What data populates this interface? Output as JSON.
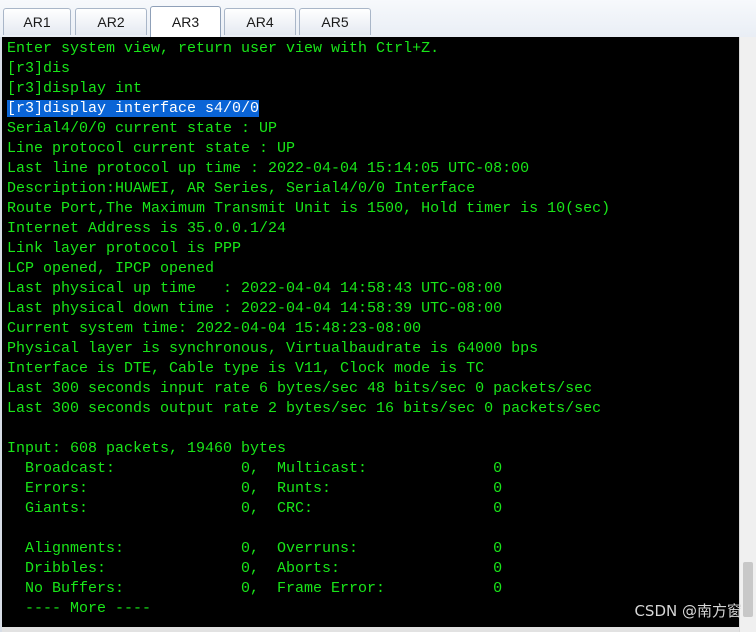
{
  "tabs": [
    {
      "label": "AR1",
      "active": false
    },
    {
      "label": "AR2",
      "active": false
    },
    {
      "label": "AR3",
      "active": true
    },
    {
      "label": "AR4",
      "active": false
    },
    {
      "label": "AR5",
      "active": false
    }
  ],
  "terminal": {
    "text_color": "#19e619",
    "background": "#000000",
    "highlight_color": "#0a64d6",
    "lines": [
      "Enter system view, return user view with Ctrl+Z.",
      "[r3]dis",
      "[r3]display int",
      "[r3]display interface s4/0/0",
      "Serial4/0/0 current state : UP",
      "Line protocol current state : UP",
      "Last line protocol up time : 2022-04-04 15:14:05 UTC-08:00",
      "Description:HUAWEI, AR Series, Serial4/0/0 Interface",
      "Route Port,The Maximum Transmit Unit is 1500, Hold timer is 10(sec)",
      "Internet Address is 35.0.0.1/24",
      "Link layer protocol is PPP",
      "LCP opened, IPCP opened",
      "Last physical up time   : 2022-04-04 14:58:43 UTC-08:00",
      "Last physical down time : 2022-04-04 14:58:39 UTC-08:00",
      "Current system time: 2022-04-04 15:48:23-08:00",
      "Physical layer is synchronous, Virtualbaudrate is 64000 bps",
      "Interface is DTE, Cable type is V11, Clock mode is TC",
      "Last 300 seconds input rate 6 bytes/sec 48 bits/sec 0 packets/sec",
      "Last 300 seconds output rate 2 bytes/sec 16 bits/sec 0 packets/sec",
      "",
      "Input: 608 packets, 19460 bytes",
      "  Broadcast:              0,  Multicast:              0",
      "  Errors:                 0,  Runts:                  0",
      "  Giants:                 0,  CRC:                    0",
      "",
      "  Alignments:             0,  Overruns:               0",
      "  Dribbles:               0,  Aborts:                 0",
      "  No Buffers:             0,  Frame Error:            0",
      "  ---- More ----"
    ],
    "highlighted_line_index": 3
  },
  "watermark": "CSDN @南方窗"
}
